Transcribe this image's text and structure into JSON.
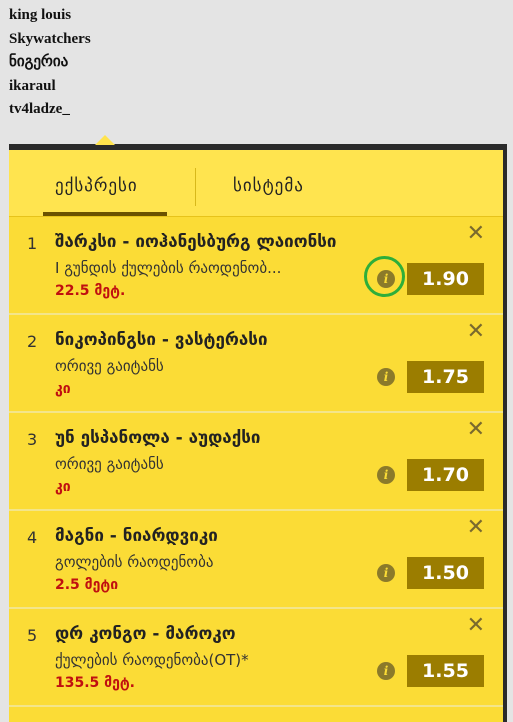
{
  "users": [
    "king louis",
    "Skywatchers",
    "ნიგერია",
    "ikaraul",
    "tv4ladze_"
  ],
  "tabs": {
    "express": "ექსპრესი",
    "system": "სისტემა"
  },
  "close_symbol": "✕",
  "info_symbol": "i",
  "bets": [
    {
      "num": "1",
      "match": "შარკსი - იოჰანესბურგ ლაიონსი",
      "market": "I გუნდის ქულების რაოდენობ...",
      "pick": "22.5 მეტ.",
      "odds": "1.90"
    },
    {
      "num": "2",
      "match": "ნიკოპინგსი - ვასტერასი",
      "market": "ორივე გაიტანს",
      "pick": "კი",
      "odds": "1.75"
    },
    {
      "num": "3",
      "match": "უნ ესპანოლა - აუდაქსი",
      "market": "ორივე გაიტანს",
      "pick": "კი",
      "odds": "1.70"
    },
    {
      "num": "4",
      "match": "მაგნი - ნიარდვიკი",
      "market": "გოლების რაოდენობა",
      "pick": "2.5 მეტი",
      "odds": "1.50"
    },
    {
      "num": "5",
      "match": "დრ კონგო - მაროკო",
      "market": "ქულების რაოდენობა(OT)*",
      "pick": "135.5 მეტ.",
      "odds": "1.55"
    }
  ],
  "colors": {
    "panel": "#fbdc36",
    "odds_bg": "#9b7d00",
    "pick": "#c01010",
    "highlight": "#2eae3a"
  }
}
